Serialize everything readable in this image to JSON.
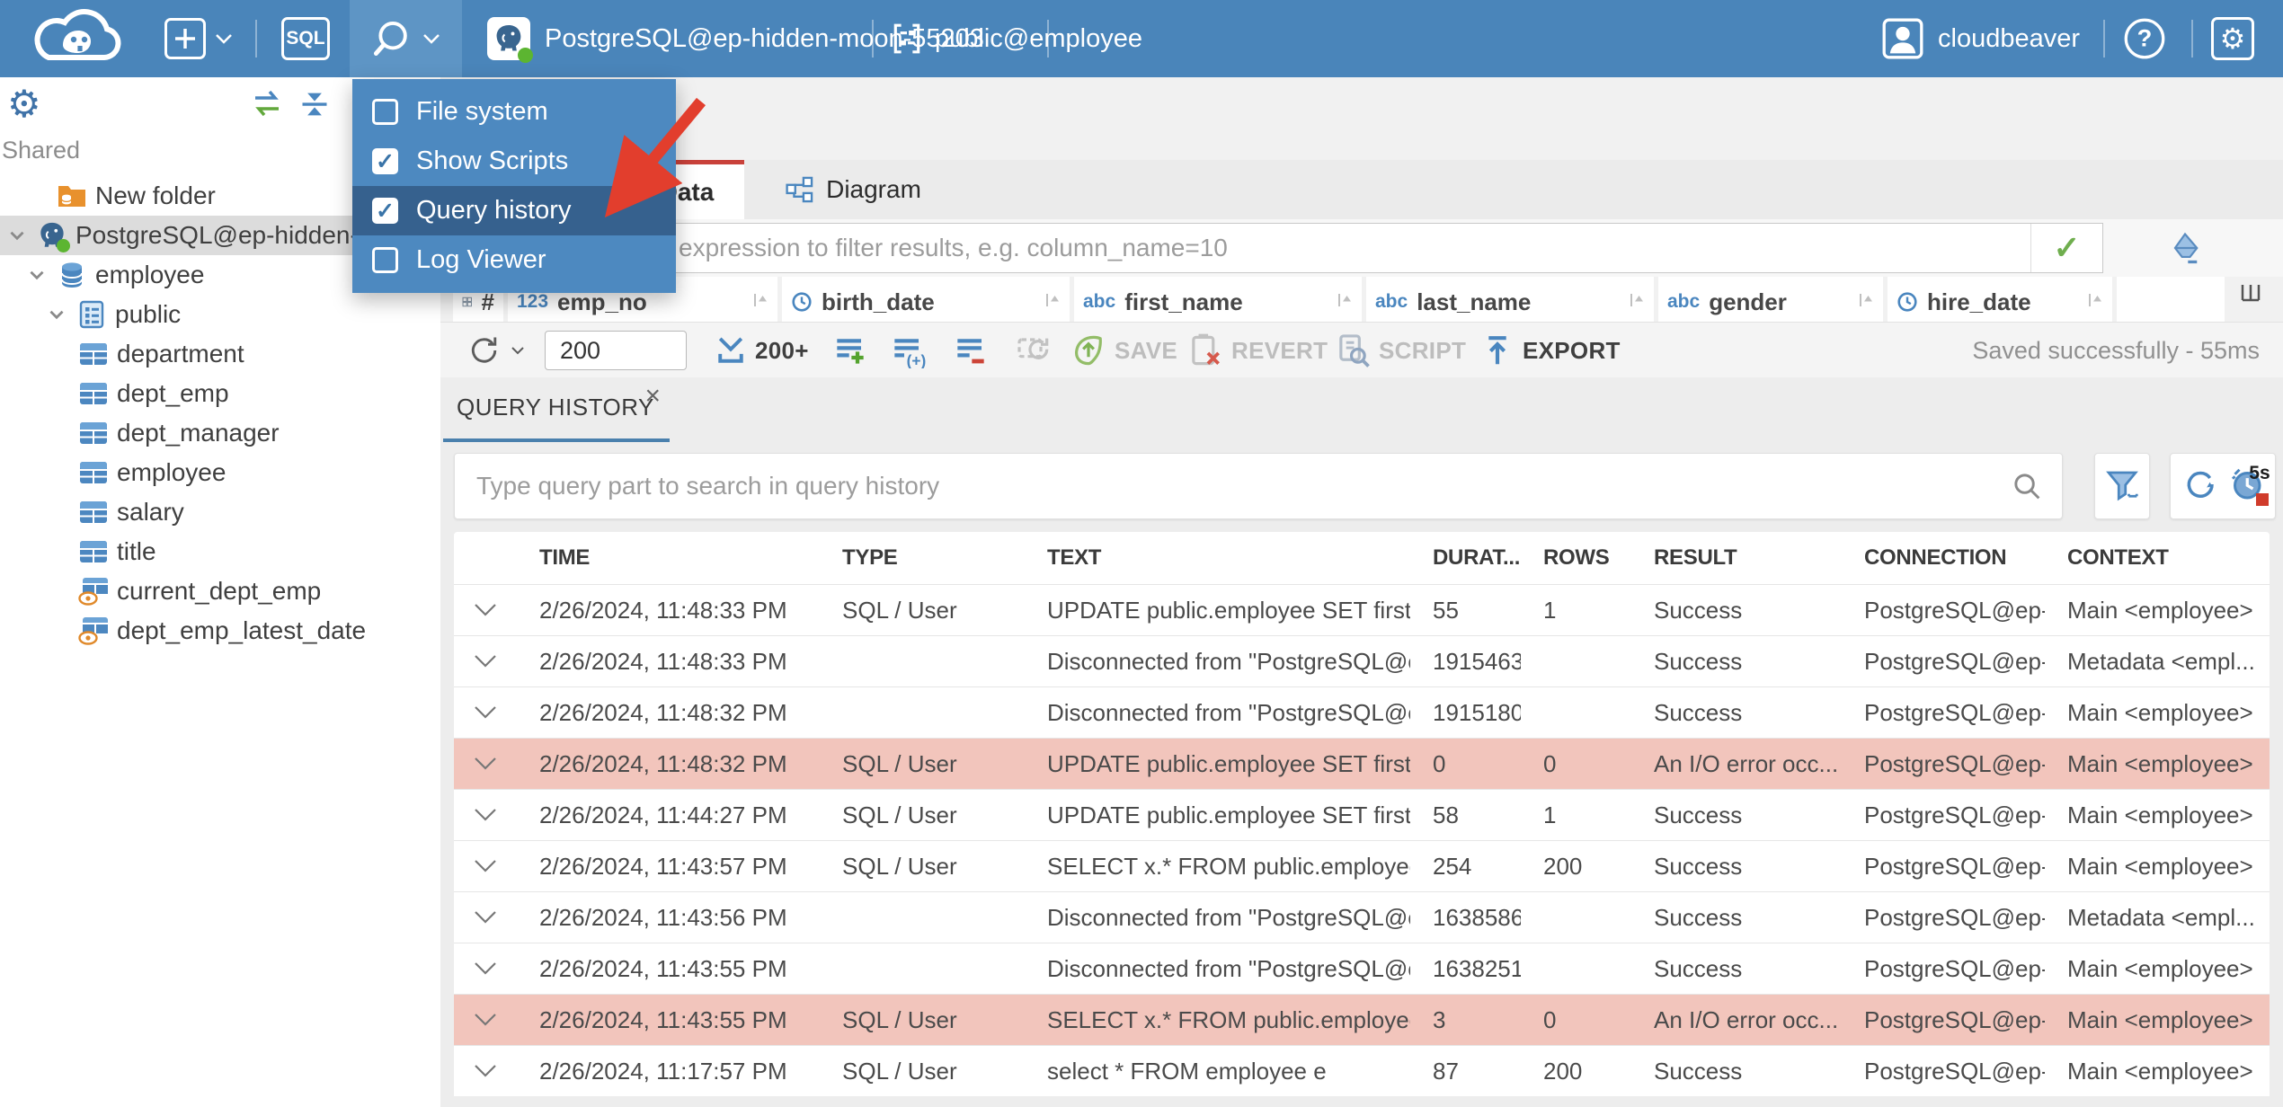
{
  "topbar": {
    "sql_button": "SQL",
    "connection_name": "PostgreSQL@ep-hidden-moon-55203",
    "schema_selector": "public@employee",
    "username": "cloudbeaver"
  },
  "tools_menu": {
    "items": [
      {
        "label": "File system",
        "checked": false,
        "highlighted": false
      },
      {
        "label": "Show Scripts",
        "checked": true,
        "highlighted": false
      },
      {
        "label": "Query history",
        "checked": true,
        "highlighted": true
      },
      {
        "label": "Log Viewer",
        "checked": false,
        "highlighted": false
      }
    ]
  },
  "sidebar": {
    "section_label": "Shared",
    "tree": [
      {
        "label": "New folder",
        "icon": "folder-database-icon",
        "indent": 1,
        "selected": false
      },
      {
        "label": "PostgreSQL@ep-hidden-",
        "icon": "postgresql-icon",
        "indent": 0,
        "expanded": true,
        "selected": true
      },
      {
        "label": "employee",
        "icon": "database-icon",
        "indent": 1,
        "expanded": true,
        "selected": false
      },
      {
        "label": "public",
        "icon": "schema-icon",
        "indent": 2,
        "expanded": true,
        "selected": false
      },
      {
        "label": "department",
        "icon": "table-icon",
        "indent": 3,
        "selected": false
      },
      {
        "label": "dept_emp",
        "icon": "table-icon",
        "indent": 3,
        "selected": false
      },
      {
        "label": "dept_manager",
        "icon": "table-icon",
        "indent": 3,
        "selected": false
      },
      {
        "label": "employee",
        "icon": "table-icon",
        "indent": 3,
        "selected": false
      },
      {
        "label": "salary",
        "icon": "table-icon",
        "indent": 3,
        "selected": false
      },
      {
        "label": "title",
        "icon": "table-icon",
        "indent": 3,
        "selected": false
      },
      {
        "label": "current_dept_emp",
        "icon": "view-icon",
        "indent": 3,
        "selected": false
      },
      {
        "label": "dept_emp_latest_date",
        "icon": "view-icon",
        "indent": 3,
        "selected": false
      }
    ]
  },
  "editor": {
    "tabs": [
      {
        "label": "Data",
        "active": true
      },
      {
        "label": "Diagram",
        "active": false
      }
    ],
    "filter_placeholder": "expression to filter results, e.g. column_name=10",
    "grid_columns": [
      {
        "name": "#",
        "glyph": ""
      },
      {
        "name": "emp_no",
        "glyph": "123"
      },
      {
        "name": "birth_date",
        "glyph": ""
      },
      {
        "name": "first_name",
        "glyph": "abc"
      },
      {
        "name": "last_name",
        "glyph": "abc"
      },
      {
        "name": "gender",
        "glyph": "abc"
      },
      {
        "name": "hire_date",
        "glyph": ""
      }
    ],
    "toolbar": {
      "row_limit": "200",
      "fetch_size_label": "200+",
      "save_label": "SAVE",
      "revert_label": "REVERT",
      "script_label": "SCRIPT",
      "export_label": "EXPORT",
      "status": "Saved successfully - 55ms"
    }
  },
  "query_history": {
    "tab_label": "QUERY HISTORY",
    "search_placeholder": "Type query part to search in query history",
    "auto_refresh_interval": "5s",
    "columns": [
      "TIME",
      "TYPE",
      "TEXT",
      "DURAT...",
      "ROWS",
      "RESULT",
      "CONNECTION",
      "CONTEXT"
    ],
    "rows": [
      {
        "time": "2/26/2024, 11:48:33 PM",
        "type": "SQL / User",
        "text": "UPDATE public.employee SET first_...",
        "duration": "55",
        "rows": "1",
        "result": "Success",
        "connection": "PostgreSQL@ep-...",
        "context": "Main <employee>",
        "error": false
      },
      {
        "time": "2/26/2024, 11:48:33 PM",
        "type": "",
        "text": "Disconnected from \"PostgreSQL@e...",
        "duration": "1915463",
        "rows": "",
        "result": "Success",
        "connection": "PostgreSQL@ep-...",
        "context": "Metadata <empl...",
        "error": false
      },
      {
        "time": "2/26/2024, 11:48:32 PM",
        "type": "",
        "text": "Disconnected from \"PostgreSQL@e...",
        "duration": "1915180",
        "rows": "",
        "result": "Success",
        "connection": "PostgreSQL@ep-...",
        "context": "Main <employee>",
        "error": false
      },
      {
        "time": "2/26/2024, 11:48:32 PM",
        "type": "SQL / User",
        "text": "UPDATE public.employee SET first_...",
        "duration": "0",
        "rows": "0",
        "result": "An I/O error occ...",
        "connection": "PostgreSQL@ep-...",
        "context": "Main <employee>",
        "error": true
      },
      {
        "time": "2/26/2024, 11:44:27 PM",
        "type": "SQL / User",
        "text": "UPDATE public.employee SET first_...",
        "duration": "58",
        "rows": "1",
        "result": "Success",
        "connection": "PostgreSQL@ep-...",
        "context": "Main <employee>",
        "error": false
      },
      {
        "time": "2/26/2024, 11:43:57 PM",
        "type": "SQL / User",
        "text": "SELECT x.* FROM public.employee x",
        "duration": "254",
        "rows": "200",
        "result": "Success",
        "connection": "PostgreSQL@ep-...",
        "context": "Main <employee>",
        "error": false
      },
      {
        "time": "2/26/2024, 11:43:56 PM",
        "type": "",
        "text": "Disconnected from \"PostgreSQL@e...",
        "duration": "1638586",
        "rows": "",
        "result": "Success",
        "connection": "PostgreSQL@ep-...",
        "context": "Metadata <empl...",
        "error": false
      },
      {
        "time": "2/26/2024, 11:43:55 PM",
        "type": "",
        "text": "Disconnected from \"PostgreSQL@e...",
        "duration": "1638251",
        "rows": "",
        "result": "Success",
        "connection": "PostgreSQL@ep-...",
        "context": "Main <employee>",
        "error": false
      },
      {
        "time": "2/26/2024, 11:43:55 PM",
        "type": "SQL / User",
        "text": "SELECT x.* FROM public.employee x",
        "duration": "3",
        "rows": "0",
        "result": "An I/O error occ...",
        "connection": "PostgreSQL@ep-...",
        "context": "Main <employee>",
        "error": true
      },
      {
        "time": "2/26/2024, 11:17:57 PM",
        "type": "SQL / User",
        "text": "select * FROM employee e",
        "duration": "87",
        "rows": "200",
        "result": "Success",
        "connection": "PostgreSQL@ep-...",
        "context": "Main <employee>",
        "error": false
      }
    ]
  },
  "colors": {
    "topbar_blue": "#4a85ba",
    "menu_highlight_blue": "#36618e",
    "accent_blue": "#4a82b8",
    "error_row_pink": "#f2c5bc",
    "active_tab_red": "#c9413a",
    "annotation_arrow_red": "#e23e2d",
    "success_green": "#6fae4e",
    "status_dot_green": "#5cb531"
  }
}
